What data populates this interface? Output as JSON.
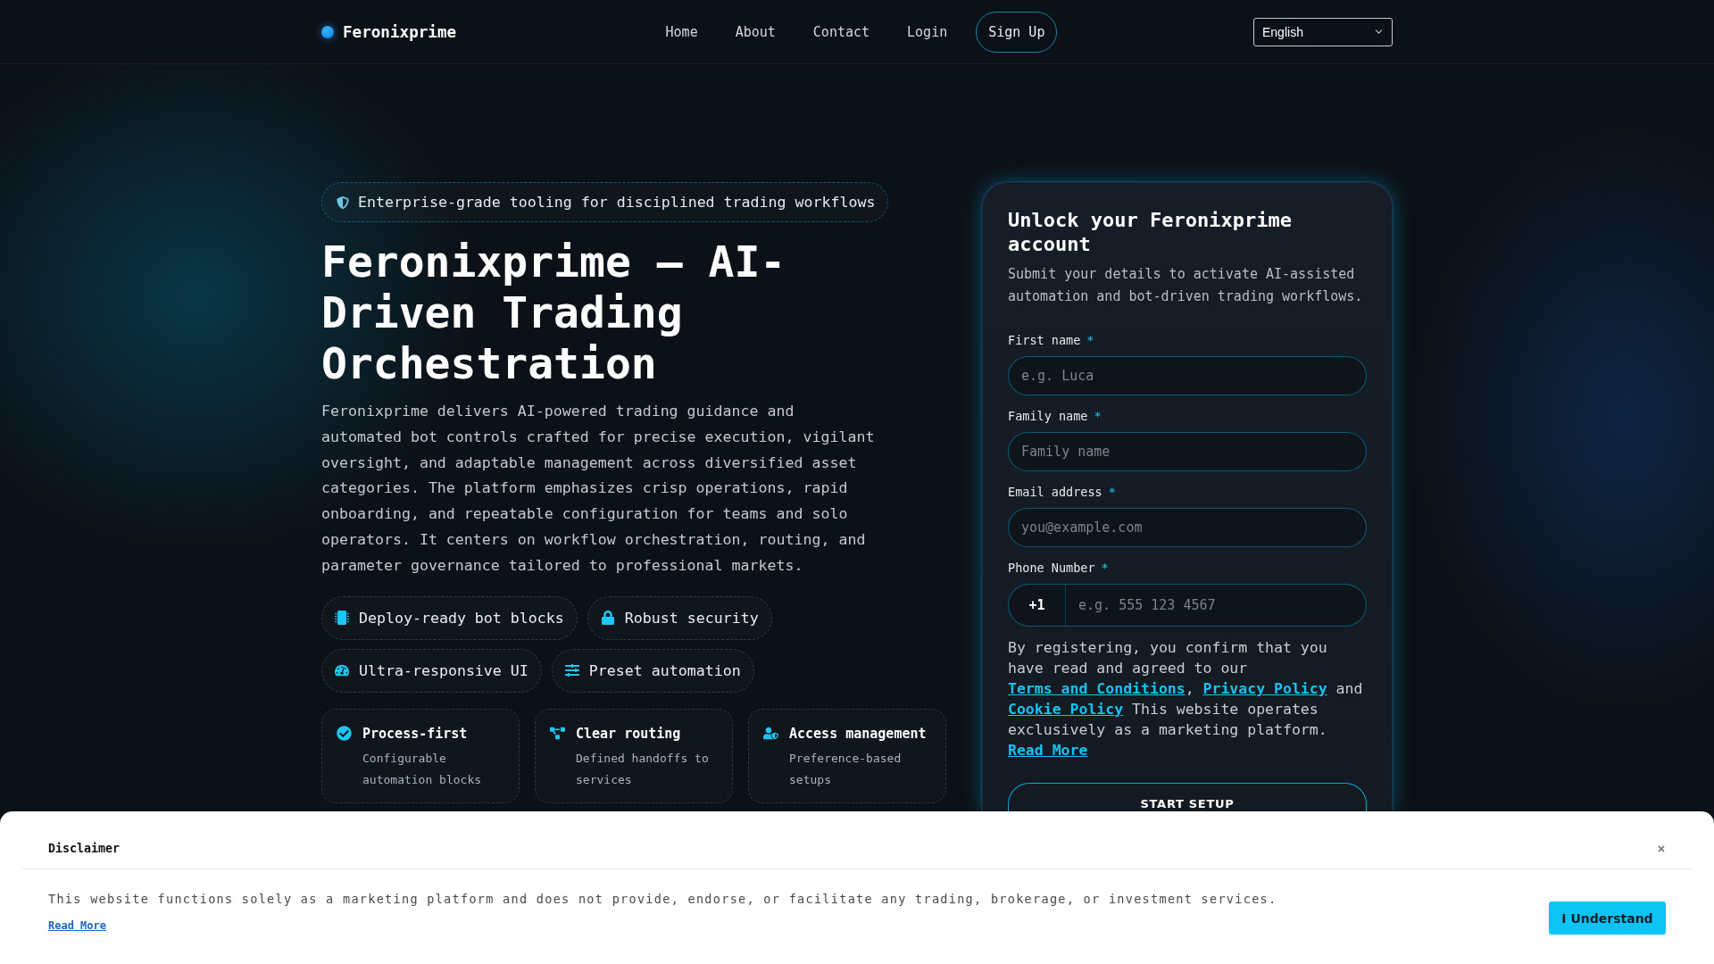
{
  "header": {
    "logo": "Feronixprime",
    "nav": [
      {
        "label": "Home"
      },
      {
        "label": "About"
      },
      {
        "label": "Contact"
      },
      {
        "label": "Login"
      }
    ],
    "cta": "Sign Up",
    "language": "English"
  },
  "hero": {
    "badge": "Enterprise-grade tooling for disciplined trading workflows",
    "title": "Feronixprime — AI-Driven Trading Orchestration",
    "description": "Feronixprime delivers AI-powered trading guidance and automated bot controls crafted for precise execution, vigilant oversight, and adaptable management across diversified asset categories. The platform emphasizes crisp operations, rapid onboarding, and repeatable configuration for teams and solo operators. It centers on workflow orchestration, routing, and parameter governance tailored to professional markets.",
    "highlights": [
      {
        "label": "Deploy-ready bot blocks"
      },
      {
        "label": "Robust security"
      },
      {
        "label": "Ultra-responsive UI"
      },
      {
        "label": "Preset automation"
      }
    ],
    "features": [
      {
        "title": "Process-first",
        "description": "Configurable automation blocks"
      },
      {
        "title": "Clear routing",
        "description": "Defined handoffs to services"
      },
      {
        "title": "Access management",
        "description": "Preference-based setups"
      }
    ]
  },
  "signup_form": {
    "title": "Unlock your Feronixprime account",
    "subtitle": "Submit your details to activate AI-assisted automation and bot-driven trading workflows.",
    "fields": [
      {
        "kind": "text",
        "label": "First name",
        "required_mark": "*",
        "placeholder": "e.g. Luca"
      },
      {
        "kind": "text",
        "label": "Family name",
        "required_mark": "*",
        "placeholder": "Family name"
      },
      {
        "kind": "text",
        "label": "Email address",
        "required_mark": "*",
        "placeholder": "you@example.com"
      },
      {
        "kind": "phone",
        "label": "Phone Number",
        "required_mark": "*",
        "prefix": "+1",
        "placeholder": "e.g. 555 123 4567"
      }
    ],
    "consent": [
      {
        "kind": "text",
        "text": "By registering, you confirm that you have read and agreed to our "
      },
      {
        "kind": "link",
        "text": "Terms and Conditions"
      },
      {
        "kind": "text",
        "text": ", "
      },
      {
        "kind": "link",
        "text": "Privacy Policy"
      },
      {
        "kind": "text",
        "text": " and "
      },
      {
        "kind": "link",
        "text": "Cookie Policy"
      },
      {
        "kind": "text",
        "text": " This website operates exclusively as a marketing platform. "
      },
      {
        "kind": "link",
        "text": "Read More"
      }
    ],
    "submit_button": "START SETUP"
  },
  "disclaimer": {
    "title": "Disclaimer",
    "text": "This website functions solely as a marketing platform and does not provide, endorse, or facilitate any trading, brokerage, or investment services.",
    "read_more": "Read More",
    "button": "I Understand"
  }
}
